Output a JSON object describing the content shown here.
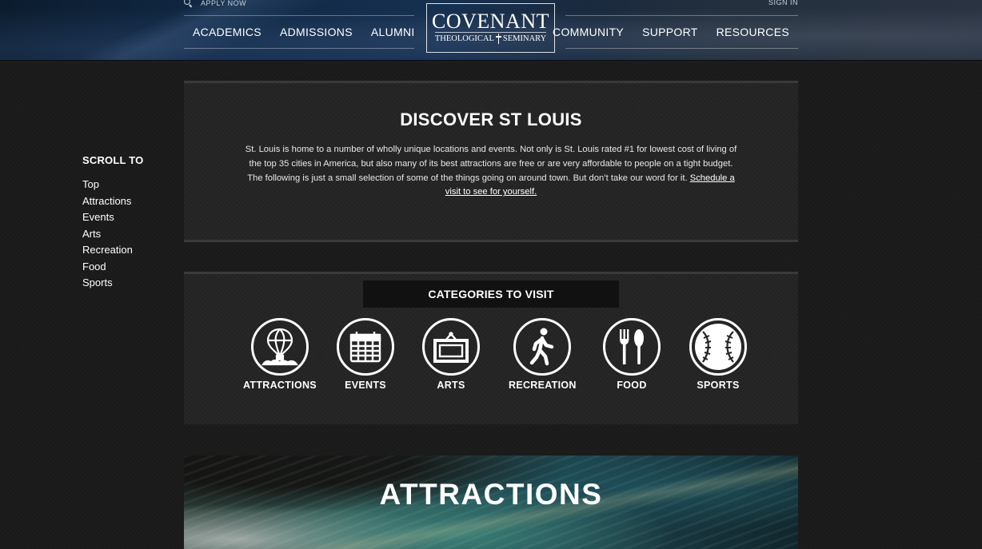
{
  "header": {
    "apply_label": "APPLY NOW",
    "signin_label": "SIGN IN",
    "nav_left": [
      "ACADEMICS",
      "ADMISSIONS",
      "ALUMNI"
    ],
    "nav_right": [
      "COMMUNITY",
      "SUPPORT",
      "RESOURCES"
    ],
    "logo": {
      "title": "COVENANT",
      "sub_left": "THEOLOGICAL",
      "sub_right": "SEMINARY"
    }
  },
  "sidebar": {
    "heading": "SCROLL TO",
    "items": [
      "Top",
      "Attractions",
      "Events",
      "Arts",
      "Recreation",
      "Food",
      "Sports"
    ]
  },
  "intro": {
    "title": "DISCOVER ST LOUIS",
    "body": "St. Louis is home to a number of wholly unique locations and events. Not only is St. Louis rated #1 for lowest cost of living of the top 35 cities in America, but also many of its best attractions are free or are very affordable to people on a tight budget. The following is just a small selection of some of the things going on around town. But don’t take our word for it. ",
    "link": "Schedule a visit to see for yourself."
  },
  "categories": {
    "title": "CATEGORIES TO VISIT",
    "items": [
      {
        "label": "ATTRACTIONS",
        "icon": "hot-air-balloon-icon"
      },
      {
        "label": "EVENTS",
        "icon": "calendar-icon"
      },
      {
        "label": "ARTS",
        "icon": "picture-frame-icon"
      },
      {
        "label": "RECREATION",
        "icon": "walking-person-icon"
      },
      {
        "label": "FOOD",
        "icon": "fork-spoon-icon"
      },
      {
        "label": "SPORTS",
        "icon": "baseball-icon"
      }
    ]
  },
  "section": {
    "title": "ATTRACTIONS"
  },
  "colors": {
    "background": "#1b1b1b",
    "panel": "#252525",
    "text": "#ffffff",
    "header_blue": "#102844"
  }
}
